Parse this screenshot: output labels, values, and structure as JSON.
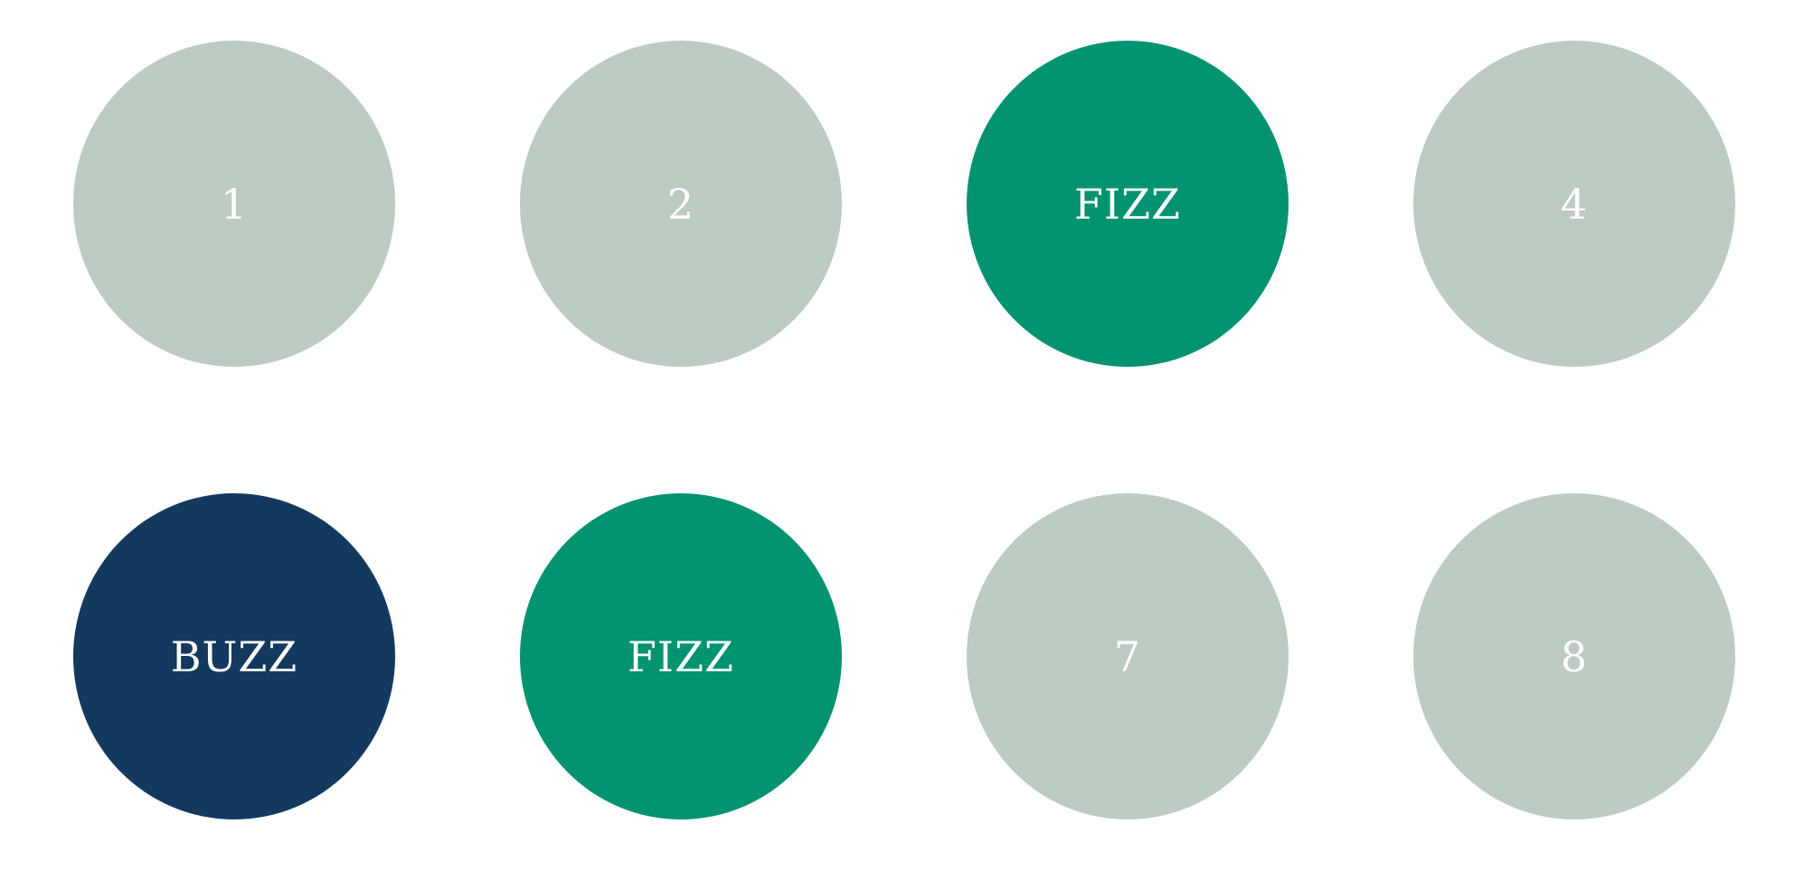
{
  "colors": {
    "background": "#ffffff",
    "number": "#bdcbc3",
    "fizz": "#039370",
    "buzz": "#13395e",
    "label": "#ffffff"
  },
  "tiles": [
    {
      "label": "1",
      "kind": "number"
    },
    {
      "label": "2",
      "kind": "number"
    },
    {
      "label": "FIZZ",
      "kind": "fizz"
    },
    {
      "label": "4",
      "kind": "number"
    },
    {
      "label": "BUZZ",
      "kind": "buzz"
    },
    {
      "label": "FIZZ",
      "kind": "fizz"
    },
    {
      "label": "7",
      "kind": "number"
    },
    {
      "label": "8",
      "kind": "number"
    }
  ]
}
